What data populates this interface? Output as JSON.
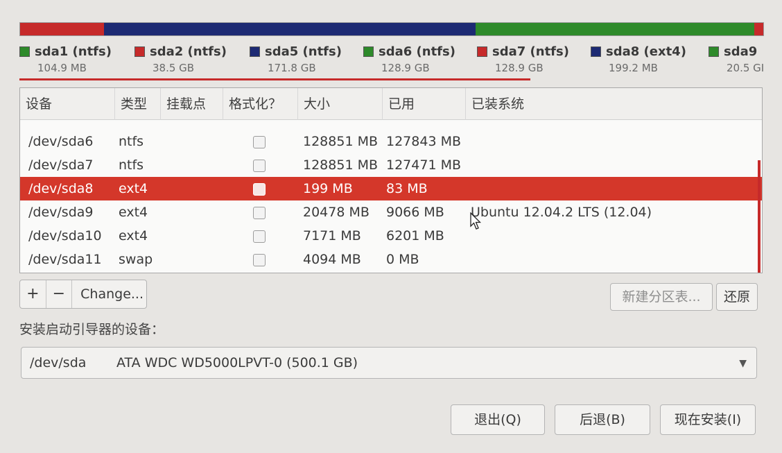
{
  "colors": {
    "ntfs_green": "#2e8a2a",
    "ntfs_red": "#c62a2a",
    "ext_navy": "#1d2a73",
    "selection": "#d4372a"
  },
  "partition_bar": [
    {
      "name": "sda2",
      "color": "#c62a2a",
      "fraction": 0.113
    },
    {
      "name": "sda5",
      "color": "#1d2a73",
      "fraction": 0.5
    },
    {
      "name": "sda6",
      "color": "#2e8a2a",
      "fraction": 0.375
    },
    {
      "name": "sda7",
      "color": "#c62a2a",
      "fraction": 0.012
    }
  ],
  "legend": [
    {
      "label": "sda1 (ntfs)",
      "size": "104.9 MB",
      "color": "#2e8a2a"
    },
    {
      "label": "sda2 (ntfs)",
      "size": "38.5 GB",
      "color": "#c62a2a"
    },
    {
      "label": "sda5 (ntfs)",
      "size": "171.8 GB",
      "color": "#1d2a73"
    },
    {
      "label": "sda6 (ntfs)",
      "size": "128.9 GB",
      "color": "#2e8a2a"
    },
    {
      "label": "sda7 (ntfs)",
      "size": "128.9 GB",
      "color": "#c62a2a"
    },
    {
      "label": "sda8 (ext4)",
      "size": "199.2 MB",
      "color": "#1d2a73"
    },
    {
      "label": "sda9",
      "size": "20.5 GI",
      "color": "#2e8a2a"
    }
  ],
  "table": {
    "headers": [
      "设备",
      "类型",
      "挂载点",
      "格式化？",
      "大小",
      "已用",
      "已装系统"
    ],
    "rows": [
      {
        "device": "/dev/sda6",
        "type": "ntfs",
        "mount": "",
        "size": "128851 MB",
        "used": "127843 MB",
        "system": ""
      },
      {
        "device": "/dev/sda7",
        "type": "ntfs",
        "mount": "",
        "size": "128851 MB",
        "used": "127471 MB",
        "system": ""
      },
      {
        "device": "/dev/sda8",
        "type": "ext4",
        "mount": "",
        "size": "199 MB",
        "used": "83 MB",
        "system": ""
      },
      {
        "device": "/dev/sda9",
        "type": "ext4",
        "mount": "",
        "size": "20478 MB",
        "used": "9066 MB",
        "system": "Ubuntu 12.04.2 LTS (12.04)"
      },
      {
        "device": "/dev/sda10",
        "type": "ext4",
        "mount": "",
        "size": "7171 MB",
        "used": "6201 MB",
        "system": ""
      },
      {
        "device": "/dev/sda11",
        "type": "swap",
        "mount": "",
        "size": "4094 MB",
        "used": "0 MB",
        "system": ""
      }
    ],
    "selected_device": "/dev/sda8"
  },
  "toolbar": {
    "add_label": "+",
    "remove_label": "−",
    "change_label": "Change...",
    "new_table_label": "新建分区表...",
    "revert_label": "还原"
  },
  "bootloader": {
    "label": "安装启动引导器的设备：",
    "device": "/dev/sda",
    "description": "ATA WDC WD5000LPVT-0 (500.1 GB)"
  },
  "footer": {
    "quit_label": "退出(Q)",
    "back_label": "后退(B)",
    "install_label": "现在安装(I)"
  }
}
